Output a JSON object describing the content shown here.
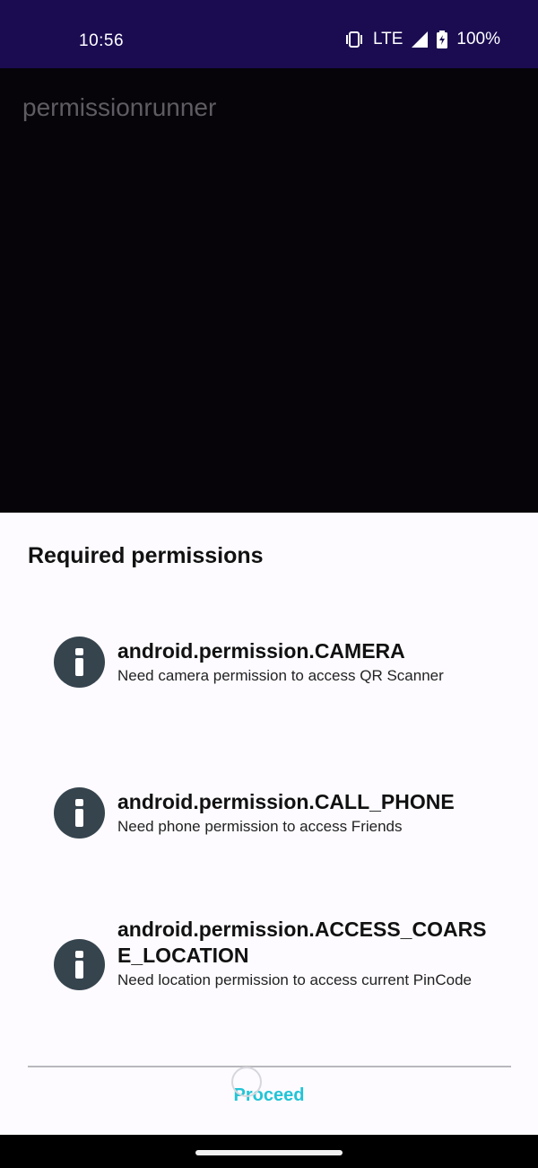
{
  "status_bar": {
    "time": "10:56",
    "network": "LTE",
    "battery": "100%",
    "icons": [
      "vibrate-icon",
      "signal-icon",
      "battery-charging-icon"
    ]
  },
  "app": {
    "title": "permissionrunner"
  },
  "sheet": {
    "title": "Required permissions",
    "permissions": [
      {
        "name": "android.permission.CAMERA",
        "description": "Need camera permission to access QR Scanner",
        "icon": "info-icon"
      },
      {
        "name": "android.permission.CALL_PHONE",
        "description": "Need phone permission to access Friends",
        "icon": "info-icon"
      },
      {
        "name": "android.permission.ACCESS_COARSE_LOCATION",
        "description": "Need location permission to access current PinCode",
        "icon": "info-icon"
      }
    ],
    "proceed_label": "Proceed"
  },
  "colors": {
    "status_bar_bg": "#1b0c52",
    "info_icon_bg": "#36444e",
    "accent": "#22c4d6"
  }
}
